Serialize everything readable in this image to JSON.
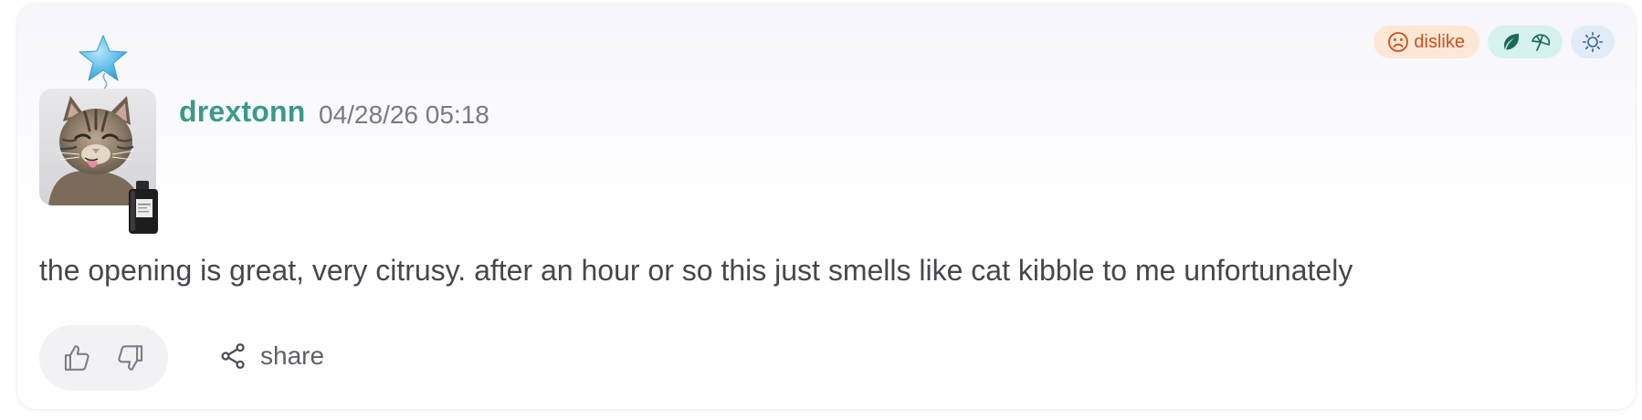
{
  "review": {
    "username": "drextonn",
    "timestamp": "04/28/26 05:18",
    "text": "the opening is great, very citrusy. after an hour or so this just smells like cat kibble to me unfortunately",
    "avatar": "cat-avatar",
    "badges": [
      "star-balloon-icon",
      "perfume-bottle-icon"
    ]
  },
  "tags": {
    "sentiment_label": "dislike",
    "sentiment_icon": "frown-icon",
    "season_icons": [
      "leaf-icon",
      "umbrella-icon"
    ],
    "time_icon": "sun-icon"
  },
  "actions": {
    "like_icon": "thumbs-up-icon",
    "dislike_icon": "thumbs-down-icon",
    "share_label": "share"
  },
  "colors": {
    "username": "#3a9a88",
    "dislike_text": "#cf4f1a",
    "dislike_bg": "#fde8d6",
    "season_bg": "#d6f2ee",
    "time_bg": "#e2ecf8"
  }
}
